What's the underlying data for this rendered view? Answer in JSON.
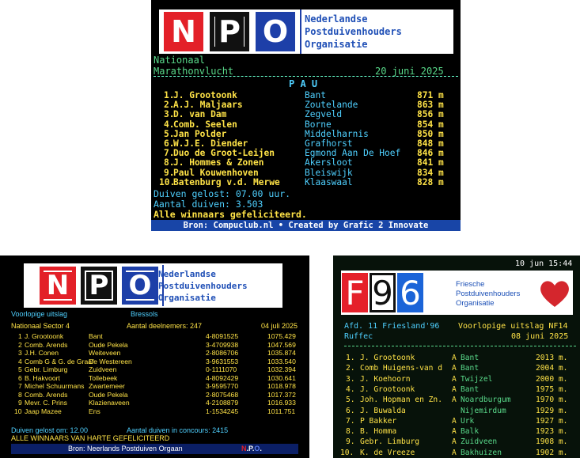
{
  "p1": {
    "org": [
      "Nederlandse",
      "Postduivenhouders",
      "Organisatie"
    ],
    "logo": [
      "N",
      "P",
      "O"
    ],
    "line1": "Nationaal",
    "race": "Marathonvlucht",
    "date": "20 juni 2025",
    "station": "P A U",
    "rows": [
      {
        "pos": "1.",
        "name": "J. Grootoonk",
        "place": "Bant",
        "dist": "871 m"
      },
      {
        "pos": "2.",
        "name": "A.J. Maljaars",
        "place": "Zoutelande",
        "dist": "863 m"
      },
      {
        "pos": "3.",
        "name": "D. van Dam",
        "place": "Zegveld",
        "dist": "856 m"
      },
      {
        "pos": "4.",
        "name": "Comb. Seelen",
        "place": "Borne",
        "dist": "854 m"
      },
      {
        "pos": "5.",
        "name": "Jan Polder",
        "place": "Middelharnis",
        "dist": "850 m"
      },
      {
        "pos": "6.",
        "name": "W.J.E. Diender",
        "place": "Grafhorst",
        "dist": "848 m"
      },
      {
        "pos": "7.",
        "name": "Duo de Groot-Leijen",
        "place": "Egmond Aan De Hoef",
        "dist": "846 m"
      },
      {
        "pos": "8.",
        "name": "J. Hommes & Zonen",
        "place": "Akersloot",
        "dist": "841 m"
      },
      {
        "pos": "9.",
        "name": "Paul Kouwenhoven",
        "place": "Bleiswijk",
        "dist": "834 m"
      },
      {
        "pos": "10.",
        "name": "Batenburg v.d. Merwe",
        "place": "Klaaswaal",
        "dist": "828 m"
      }
    ],
    "released": "Duiven gelost: 07.00 uur.",
    "count": "Aantal duiven: 3.503",
    "congrats": "Alle winnaars gefeliciteerd.",
    "footer": "Bron: Compuclub.nl • Created by Grafic 2 Innovate"
  },
  "p2": {
    "org": [
      "Nederlandse",
      "Postduivenhouders",
      "Organisatie"
    ],
    "logo": [
      "N",
      "P",
      "O"
    ],
    "status": "Voorlopige uitslag",
    "station": "Bressols",
    "sector": "Nationaal Sector 4",
    "participants": "Aantal deelnemers: 247",
    "date": "04 juli 2025",
    "rows": [
      {
        "pos": "1",
        "name": "J. Grootoonk",
        "place": "Bant",
        "ring": "4-8091525",
        "speed": "1075.429"
      },
      {
        "pos": "2",
        "name": "Comb. Arends",
        "place": "Oude Pekela",
        "ring": "3-4709938",
        "speed": "1047.569"
      },
      {
        "pos": "3",
        "name": "J.H. Conen",
        "place": "Weiteveen",
        "ring": "2-8086706",
        "speed": "1035.874"
      },
      {
        "pos": "4",
        "name": "Comb G & G. de Graaf",
        "place": "De Westereen",
        "ring": "3-9631553",
        "speed": "1033.540"
      },
      {
        "pos": "5",
        "name": "Gebr. Limburg",
        "place": "Zuidveen",
        "ring": "0-1111070",
        "speed": "1032.394"
      },
      {
        "pos": "6",
        "name": "B. Hakvoort",
        "place": "Tollebeek",
        "ring": "4-8092429",
        "speed": "1030.641"
      },
      {
        "pos": "7",
        "name": "Michel Schuurmans",
        "place": "Zwartemeer",
        "ring": "3-9595770",
        "speed": "1018.978"
      },
      {
        "pos": "8",
        "name": "Comb. Arends",
        "place": "Oude Pekela",
        "ring": "2-8075468",
        "speed": "1017.372"
      },
      {
        "pos": "9",
        "name": "Mevr. C. Prins",
        "place": "Klazienaveen",
        "ring": "4-2108879",
        "speed": "1016.933"
      },
      {
        "pos": "10",
        "name": "Jaap Mazee",
        "place": "Ens",
        "ring": "1-1534245",
        "speed": "1011.751"
      }
    ],
    "released": "Duiven gelost om: 12.00",
    "count": "Aantal duiven in concours: 2415",
    "congrats": "ALLE WINNAARS VAN HARTE GEFELICITEERD",
    "footer": "Bron: Neerlands Postduiven Orgaan",
    "footer_mark": [
      "N",
      ".",
      "P",
      ".",
      "O",
      "."
    ]
  },
  "p3": {
    "clock": "10 jun 15:44",
    "logo": [
      "F",
      "9",
      "6"
    ],
    "org": [
      "Friesche",
      "Postduivenhouders",
      "Organisatie"
    ],
    "afd": "Afd. 11 Friesland'96",
    "status": "Voorlopige uitslag NF14",
    "station": "Ruffec",
    "date": "08 juni 2025",
    "rows": [
      {
        "pos": "1.",
        "name": "J. Grootoonk",
        "cat": "A",
        "place": "Bant",
        "dist": "2013 m."
      },
      {
        "pos": "2.",
        "name": "Comb Huigens-van d",
        "cat": "A",
        "place": "Bant",
        "dist": "2004 m."
      },
      {
        "pos": "3.",
        "name": "J. Koehoorn",
        "cat": "A",
        "place": "Twijzel",
        "dist": "2000 m."
      },
      {
        "pos": "4.",
        "name": "J. Grootoonk",
        "cat": "A",
        "place": "Bant",
        "dist": "1975 m."
      },
      {
        "pos": "5.",
        "name": "Joh. Hopman en Zn.",
        "cat": "A",
        "place": "Noardburgum",
        "dist": "1970 m."
      },
      {
        "pos": "6.",
        "name": "J. Buwalda",
        "cat": "",
        "place": "Nijemirdum",
        "dist": "1929 m."
      },
      {
        "pos": "7.",
        "name": "P Bakker",
        "cat": "A",
        "place": "Urk",
        "dist": "1927 m."
      },
      {
        "pos": "8.",
        "name": "B. Homma",
        "cat": "A",
        "place": "Balk",
        "dist": "1923 m."
      },
      {
        "pos": "9.",
        "name": "Gebr. Limburg",
        "cat": "A",
        "place": "Zuidveen",
        "dist": "1908 m."
      },
      {
        "pos": "10.",
        "name": "K. de Vreeze",
        "cat": "A",
        "place": "Bakhuizen",
        "dist": "1902 m."
      }
    ]
  },
  "colors": {
    "yellow": "#ffe347",
    "cyan": "#4fd0ff",
    "green": "#59d98a",
    "blue_bar": "#1845a7",
    "navy": "#0b1f66",
    "red": "#e32028",
    "logo_blue": "#1d3fa8",
    "nf_red": "#e5202a",
    "nf_blue": "#1b64d8"
  }
}
